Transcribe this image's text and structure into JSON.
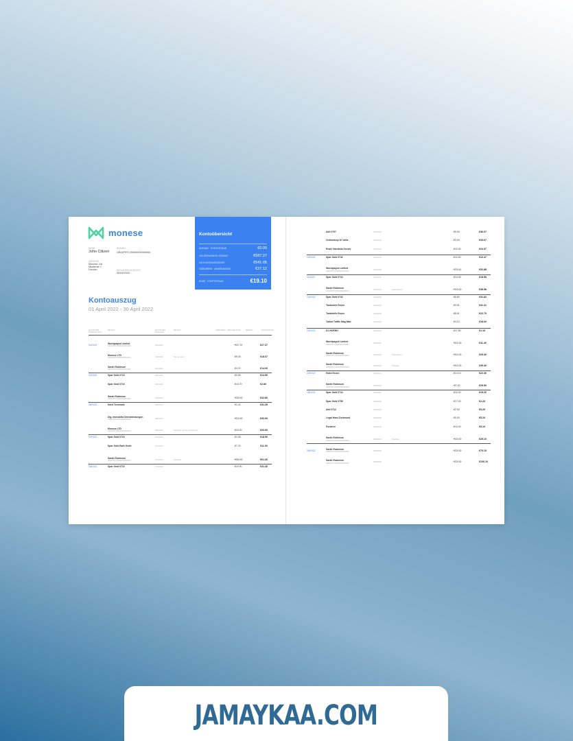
{
  "brand": {
    "name": "monese",
    "logo_color": "#3a86e8",
    "logo_mark_color": "#4fd1a5"
  },
  "account": {
    "name_label": "NAME",
    "name": "John Citizen",
    "iban_label": "IBAN/BIC",
    "iban": "GB11PRTC00000000000000",
    "address_label": "ADRESSE",
    "address_lines": [
      "Monese Ltd",
      "Musterstr 1",
      "London"
    ],
    "date_label": "DATUM DES AUSZUGS",
    "date": "30/04/2022"
  },
  "summary": {
    "title": "Kontoübersicht",
    "rows": [
      {
        "label": "ANFANG · KONTOSTAND",
        "value": "€0.00"
      },
      {
        "label": "GELDEINGÄNGE GESAMT",
        "value": "€587.27"
      },
      {
        "label": "ZAHLUNGSAUSGÄNGE",
        "value": "€541.05"
      },
      {
        "label": "GEBÜHREN · ABHEBUNGEN",
        "value": "€27.12"
      }
    ],
    "total_label": "ENDE · KONTOSTAND",
    "total_value": "€19.10",
    "color": "#3b82f0"
  },
  "statement": {
    "title": "Kontoauszug",
    "period": "01 April 2022 - 30 April 2022"
  },
  "table_headers": [
    "DATUM DER TRANSAKTION",
    "DETAILS",
    "DATUM DER BUCHUNG",
    "DETAILS",
    "GEBÜHREN · WECHSELKURS",
    "BETRAG",
    "KONTOSTAND"
  ],
  "left_rows": [
    {
      "date": "01/04/22",
      "desc": "Worldpayuk Limited",
      "sub": "GB11PRTC00000000000000",
      "book": "01/04/22",
      "note": "",
      "amt": "+€27.37",
      "bal": "€27.37",
      "line_before": false
    },
    {
      "date": "",
      "desc": "Monese LTD",
      "sub": "GB11PRTC00000000000000",
      "book": "01/04/22",
      "note": "Top up card",
      "amt": "-€9.00",
      "bal": "€18.37",
      "line_before": false
    },
    {
      "date": "",
      "desc": "Sarah Robinson",
      "sub": "GB11PRTC00000000000000",
      "book": "01/04/22",
      "note": "",
      "amt": "-€4.37",
      "bal": "€14.00",
      "line_before": false
    },
    {
      "date": "02/04/22",
      "desc": "Spar Gold 0710",
      "sub": "",
      "book": "02/04/22",
      "note": "",
      "amt": "-€0.50",
      "bal": "€13.50",
      "line_before": true
    },
    {
      "date": "",
      "desc": "Spar Gold 0710",
      "sub": "",
      "book": "02/04/22",
      "note": "",
      "amt": "-€10.70",
      "bal": "€2.80",
      "line_before": false
    },
    {
      "date": "",
      "desc": "Sarah Robinson",
      "sub": "GB11PRTC00000000000000",
      "book": "02/04/22",
      "note": "",
      "amt": "+€30.00",
      "bal": "€32.80",
      "line_before": false
    },
    {
      "date": "05/04/22",
      "desc": "Nord Terminals",
      "sub": "",
      "book": "05/04/22",
      "note": "",
      "amt": "-€1.41",
      "bal": "€31.39",
      "line_before": true
    },
    {
      "date": "",
      "desc": "Dig. Immobilia Dienstleistungen",
      "sub": "GB11PRTC00000000000000",
      "book": "06/04/22",
      "note": "",
      "amt": "+€10.00",
      "bal": "€30.00",
      "line_before": false
    },
    {
      "date": "",
      "desc": "Monese LTD",
      "sub": "GB11PRTC00000000000000",
      "book": "06/04/22",
      "note": "Sending money to Monese",
      "amt": "-€10.00",
      "bal": "€20.00",
      "line_before": false
    },
    {
      "date": "07/04/22",
      "desc": "Spar Gold 0710",
      "sub": "",
      "book": "07/04/22",
      "note": "",
      "amt": "-€1.50",
      "bal": "€18.50",
      "line_before": true
    },
    {
      "date": "",
      "desc": "Spar Gold Rath Grahl",
      "sub": "",
      "book": "07/04/22",
      "note": "",
      "amt": "-€7.20",
      "bal": "€11.30",
      "line_before": false
    },
    {
      "date": "",
      "desc": "Sarah Robinson",
      "sub": "GB11PRTC00000000000000",
      "book": "07/04/22",
      "note": "Festival",
      "amt": "+€50.00",
      "bal": "€61.30",
      "line_before": false
    },
    {
      "date": "08/04/22",
      "desc": "Spar Gold 0710",
      "sub": "",
      "book": "07/04/22",
      "note": "",
      "amt": "-€19.90",
      "bal": "€41.40",
      "line_before": true
    }
  ],
  "right_rows": [
    {
      "date": "",
      "desc": "Aldi 0707",
      "sub": "",
      "book": "07/04/22",
      "note": "",
      "amt": "-€5.00",
      "bal": "€36.07",
      "line_before": false
    },
    {
      "date": "",
      "desc": "Onlineshop Dr Volta",
      "sub": "",
      "book": "07/04/22",
      "note": "",
      "amt": "-€3.00",
      "bal": "€33.07",
      "line_before": false
    },
    {
      "date": "",
      "desc": "Rosie Nandiola Gruvio",
      "sub": "",
      "book": "07/04/22",
      "note": "",
      "amt": "-€10.00",
      "bal": "€23.07",
      "line_before": false
    },
    {
      "date": "10/04/22",
      "desc": "Spar Gold 0742",
      "sub": "",
      "book": "10/04/22",
      "note": "",
      "amt": "-€10.60",
      "bal": "€12.47",
      "line_before": true
    },
    {
      "date": "",
      "desc": "Worldpayuk Limited",
      "sub": "GB11PRTC00000000000000",
      "book": "10/04/22",
      "note": "",
      "amt": "+€20.41",
      "bal": "€32.88",
      "line_before": false
    },
    {
      "date": "11/04/22",
      "desc": "Spar Gold 0744",
      "sub": "",
      "book": "11/04/22",
      "note": "",
      "amt": "-€14.30",
      "bal": "€18.58",
      "line_before": true
    },
    {
      "date": "",
      "desc": "Sarah Robinson",
      "sub": "GB11PRTC00000000000000",
      "book": "11/04/22",
      "note": "Festival 2.0",
      "amt": "+€20.00",
      "bal": "€38.58",
      "line_before": false
    },
    {
      "date": "12/04/22",
      "desc": "Spar Gold 0742",
      "sub": "",
      "book": "12/04/22",
      "note": "",
      "amt": "-€6.80",
      "bal": "€31.82",
      "line_before": true
    },
    {
      "date": "",
      "desc": "Tankstelle Essen",
      "sub": "",
      "book": "12/04/22",
      "note": "",
      "amt": "-€0.51",
      "bal": "€31.31",
      "line_before": false
    },
    {
      "date": "",
      "desc": "Tankstelle Essen",
      "sub": "",
      "book": "12/04/22",
      "note": "",
      "amt": "-€8.61",
      "bal": "€22.70",
      "line_before": false
    },
    {
      "date": "",
      "desc": "Talbot Traffic Mag Mad",
      "sub": "",
      "book": "13/04/22",
      "note": "",
      "amt": "-€4.10",
      "bal": "€18.60",
      "line_before": false
    },
    {
      "date": "13/04/22",
      "desc": "DJ-HOENH",
      "sub": "",
      "book": "13/04/22",
      "note": "",
      "amt": "-€17.50",
      "bal": "€1.10",
      "line_before": true
    },
    {
      "date": "",
      "desc": "Worldpayuk Limited",
      "sub": "GB11PRTC00000000000000",
      "book": "14/04/22",
      "note": "",
      "amt": "+€10.30",
      "bal": "€11.40",
      "line_before": false
    },
    {
      "date": "",
      "desc": "Sarah Robinson",
      "sub": "GB11PRTC00000000000000",
      "book": "14/04/22",
      "note": "Festival 2.0",
      "amt": "+€14.00",
      "bal": "€25.40",
      "line_before": false
    },
    {
      "date": "",
      "desc": "Sarah Robinson",
      "sub": "GB11PRTC00000000000000",
      "book": "15/04/22",
      "note": "Festival",
      "amt": "+€10.00",
      "bal": "€35.40",
      "line_before": false
    },
    {
      "date": "16/04/22",
      "desc": "Hobs Essen",
      "sub": "",
      "book": "16/04/22",
      "note": "",
      "amt": "-€13.10",
      "bal": "€22.30",
      "line_before": true
    },
    {
      "date": "",
      "desc": "Sarah Robinson",
      "sub": "GB11PRTC00000000000000",
      "book": "16/04/22",
      "note": "",
      "amt": "+€7.20",
      "bal": "€29.50",
      "line_before": false
    },
    {
      "date": "18/04/22",
      "desc": "Spar Gold 0744",
      "sub": "",
      "book": "18/04/22",
      "note": "",
      "amt": "-€10.30",
      "bal": "€19.20",
      "line_before": true
    },
    {
      "date": "",
      "desc": "Spar Gold 0758",
      "sub": "",
      "book": "19/04/22",
      "note": "",
      "amt": "-€17.00",
      "bal": "€2.20",
      "line_before": false
    },
    {
      "date": "",
      "desc": "Aldi 0712",
      "sub": "",
      "book": "19/04/22",
      "note": "",
      "amt": "-€2.00",
      "bal": "€0.20",
      "line_before": false
    },
    {
      "date": "",
      "desc": "Legal Haus Dortmund",
      "sub": "",
      "book": "19/04/22",
      "note": "",
      "amt": "-€5.00",
      "bal": "€5.10",
      "line_before": false
    },
    {
      "date": "",
      "desc": "Forderer",
      "sub": "",
      "book": "19/04/22",
      "note": "",
      "amt": "-€10.00",
      "bal": "€5.10",
      "line_before": false
    },
    {
      "date": "",
      "desc": "Sarah Robinson",
      "sub": "GB11PRTC00000000000000",
      "book": "20/04/22",
      "note": "Festival",
      "amt": "+€20.00",
      "bal": "€25.10",
      "line_before": false
    },
    {
      "date": "28/04/22",
      "desc": "Sarah Robinson",
      "sub": "GB11PRTC00000000000000",
      "book": "28/04/22",
      "note": "",
      "amt": "+€20.00",
      "bal": "€70.10",
      "line_before": true
    },
    {
      "date": "",
      "desc": "Sarah Robinson",
      "sub": "GB11PRTC00000000000000",
      "book": "28/04/22",
      "note": "",
      "amt": "+€20.00",
      "bal": "€100.10",
      "line_before": false
    }
  ],
  "watermark": {
    "text": "JAMAYKAA.COM",
    "color": "#2e6a93"
  }
}
